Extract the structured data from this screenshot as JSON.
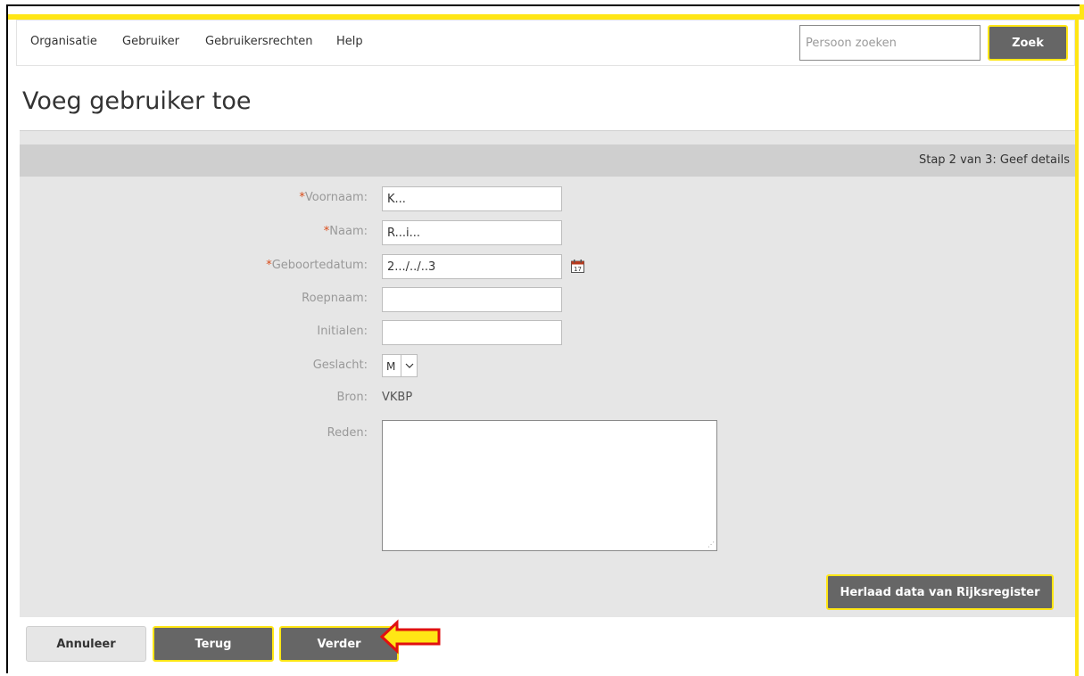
{
  "nav": {
    "items": [
      "Organisatie",
      "Gebruiker",
      "Gebruikersrechten",
      "Help"
    ],
    "search_placeholder": "Persoon zoeken",
    "search_button": "Zoek"
  },
  "page": {
    "title": "Voeg gebruiker toe",
    "step": "Stap 2 van 3: Geef details"
  },
  "form": {
    "voornaam": {
      "label": "Voornaam:",
      "required": true,
      "value": "K..."
    },
    "naam": {
      "label": "Naam:",
      "required": true,
      "value": "R...i..."
    },
    "geboortedatum": {
      "label": "Geboortedatum:",
      "required": true,
      "value": "2.../../..3"
    },
    "roepnaam": {
      "label": "Roepnaam:",
      "value": ""
    },
    "initialen": {
      "label": "Initialen:",
      "value": ""
    },
    "geslacht": {
      "label": "Geslacht:",
      "value": "M"
    },
    "bron": {
      "label": "Bron:",
      "value": "VKBP"
    },
    "reden": {
      "label": "Reden:",
      "value": ""
    },
    "required_marker": "*"
  },
  "buttons": {
    "herlaad": "Herlaad data van Rijksregister",
    "annuleer": "Annuleer",
    "terug": "Terug",
    "verder": "Verder"
  },
  "calendar_icon_day": "17",
  "colors": {
    "accent": "#ffe615",
    "button": "#666666",
    "required": "#d94c1a",
    "panel": "#e6e6e6",
    "highlight_arrow_fill": "#ffe615",
    "highlight_arrow_stroke": "#e01010"
  }
}
